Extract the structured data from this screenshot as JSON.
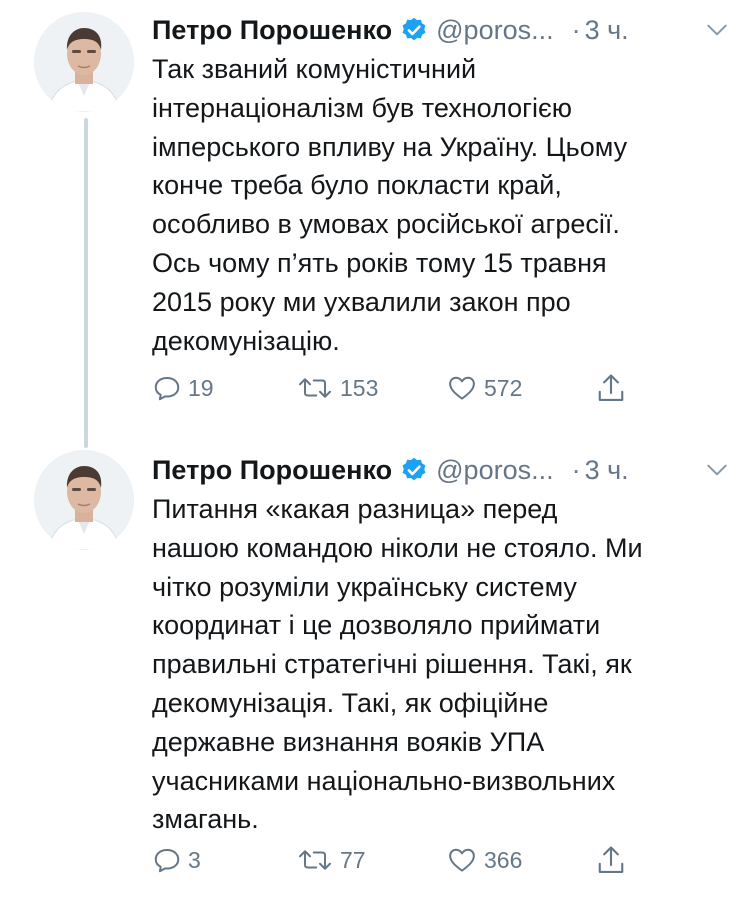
{
  "colors": {
    "text": "#14171a",
    "muted": "#657786",
    "verified": "#1da1f2",
    "thread_line": "#ccd6dd"
  },
  "tweets": [
    {
      "author_name": "Петро Порошенко",
      "handle": "@poros...",
      "dot": "·",
      "time": "3 ч.",
      "avatar_icon": "profile-photo",
      "verified_icon": "verified-badge-icon",
      "text_lines": [
        "Так званий комуністичний",
        "інтернаціоналізм був технологією",
        "імперського впливу на Україну. Цьому",
        "конче треба було покласти край,",
        "особливо в умовах російської агресії.",
        "Ось чому п’ять років тому 15 травня",
        "2015 року ми ухвалили закон про",
        "декомунізацію."
      ],
      "replies": "19",
      "retweets": "153",
      "likes": "572"
    },
    {
      "author_name": "Петро Порошенко",
      "handle": "@poros...",
      "dot": "·",
      "time": "3 ч.",
      "avatar_icon": "profile-photo",
      "verified_icon": "verified-badge-icon",
      "text_lines": [
        "Питання «какая разница» перед",
        "нашою командою ніколи не стояло. Ми",
        "чітко розуміли українську систему",
        "координат і це дозволяло приймати",
        "правильні стратегічні рішення. Такі, як",
        "декомунізація. Такі, як офіційне",
        "державне визнання вояків УПА",
        "учасниками національно-визвольних",
        "змагань."
      ],
      "replies": "3",
      "retweets": "77",
      "likes": "366"
    }
  ]
}
